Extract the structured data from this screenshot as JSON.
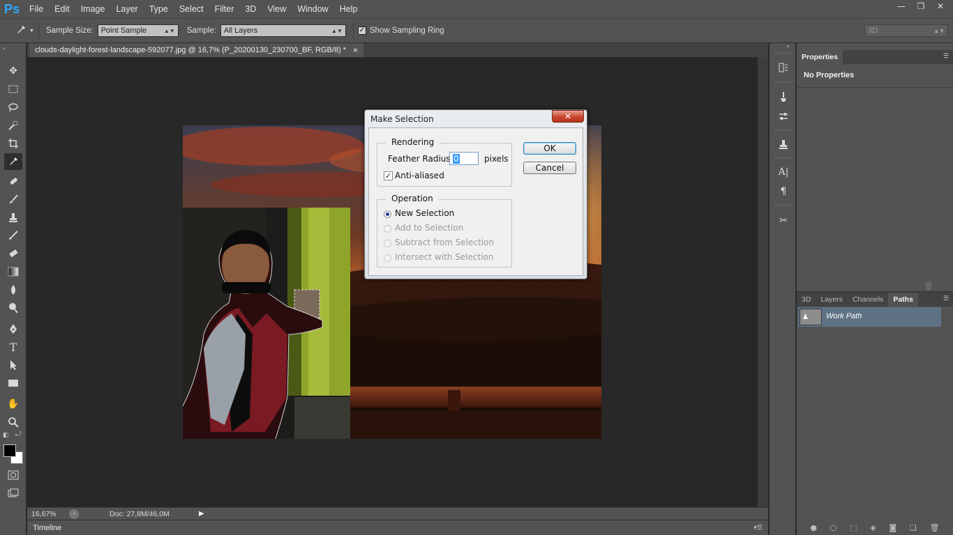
{
  "app": {
    "logo": "Ps",
    "menu": [
      "File",
      "Edit",
      "Image",
      "Layer",
      "Type",
      "Select",
      "Filter",
      "3D",
      "View",
      "Window",
      "Help"
    ],
    "window_controls": [
      "—",
      "❐",
      "✕"
    ]
  },
  "options_bar": {
    "sample_size_label": "Sample Size:",
    "sample_size_value": "Point Sample",
    "sample_label": "Sample:",
    "sample_value": "All Layers",
    "show_sampling_ring_label": "Show Sampling Ring",
    "show_sampling_ring_checked": true,
    "workspace_value": "3D"
  },
  "document": {
    "tab_title": "clouds-daylight-forest-landscape-592077.jpg @ 16,7% (P_20200130_230700_BF, RGB/8) *",
    "tab_close": "×"
  },
  "status": {
    "zoom": "16,67%",
    "doc_info": "Doc: 27,8M/46,0M",
    "timeline_label": "Timeline"
  },
  "properties_panel": {
    "tab": "Properties",
    "content": "No Properties"
  },
  "paths_panel": {
    "tabs": [
      "3D",
      "Layers",
      "Channels",
      "Paths"
    ],
    "active_tab": "Paths",
    "items": [
      {
        "name": "Work Path"
      }
    ]
  },
  "dialog": {
    "title": "Make Selection",
    "close": "✕",
    "rendering_label": "Rendering",
    "feather_label": "Feather Radius:",
    "feather_value": "0",
    "feather_unit": "pixels",
    "anti_aliased_label": "Anti-aliased",
    "anti_aliased_checked": true,
    "operation_label": "Operation",
    "operations": [
      {
        "label": "New Selection",
        "selected": true,
        "enabled": true
      },
      {
        "label": "Add to Selection",
        "selected": false,
        "enabled": false
      },
      {
        "label": "Subtract from Selection",
        "selected": false,
        "enabled": false
      },
      {
        "label": "Intersect with Selection",
        "selected": false,
        "enabled": false
      }
    ],
    "ok_label": "OK",
    "cancel_label": "Cancel"
  },
  "colors": {
    "ui_gray": "#535353",
    "canvas_bg": "#282828",
    "ps_blue": "#31a8ff",
    "selected_row": "#5f7185"
  }
}
